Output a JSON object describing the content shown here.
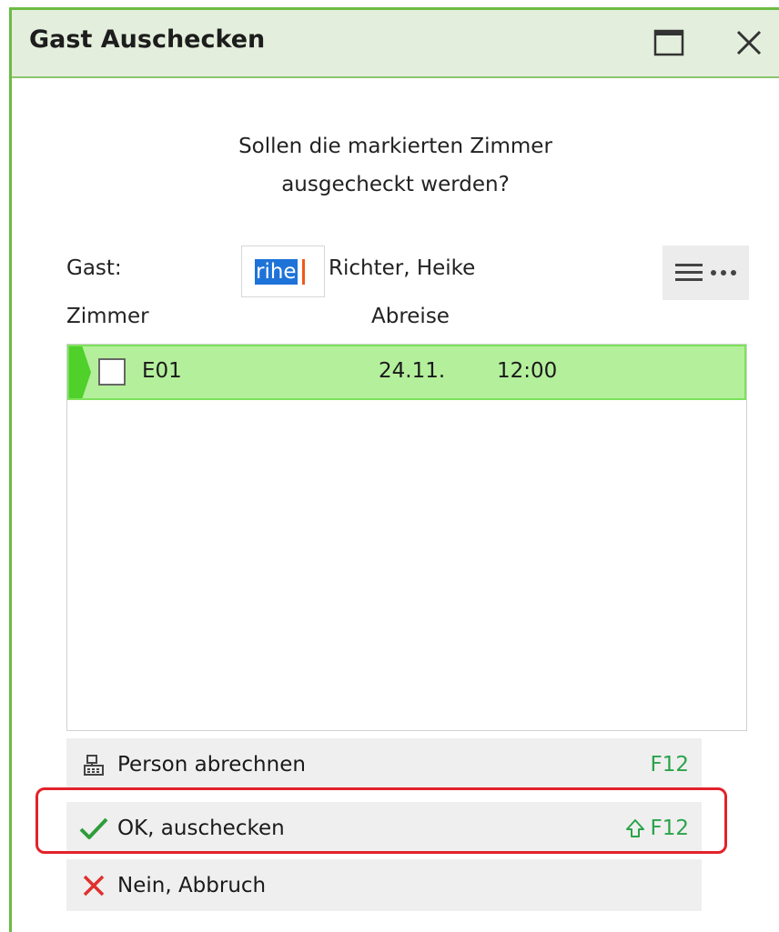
{
  "window": {
    "title": "Gast Auschecken"
  },
  "dialog": {
    "prompt_line1": "Sollen die markierten Zimmer",
    "prompt_line2": "ausgecheckt werden?"
  },
  "guest": {
    "label": "Gast:",
    "code_value": "rihe",
    "name": "Richter, Heike"
  },
  "rooms": {
    "columns": {
      "room": "Zimmer",
      "departure": "Abreise"
    },
    "rows": [
      {
        "room": "E01",
        "date": "24.11.",
        "time": "12:00",
        "checked": false
      }
    ]
  },
  "actions": {
    "bill": {
      "label": "Person abrechnen",
      "shortcut": "F12"
    },
    "ok": {
      "label": "OK, auschecken",
      "shortcut": "F12",
      "modifier_icon": "shift-icon"
    },
    "cancel": {
      "label": "Nein, Abbruch"
    }
  },
  "colors": {
    "accent_green": "#6dbb45",
    "selected_row": "#b4ef9c",
    "shortcut_green": "#2aa34a",
    "highlight_red": "#e2222a"
  }
}
